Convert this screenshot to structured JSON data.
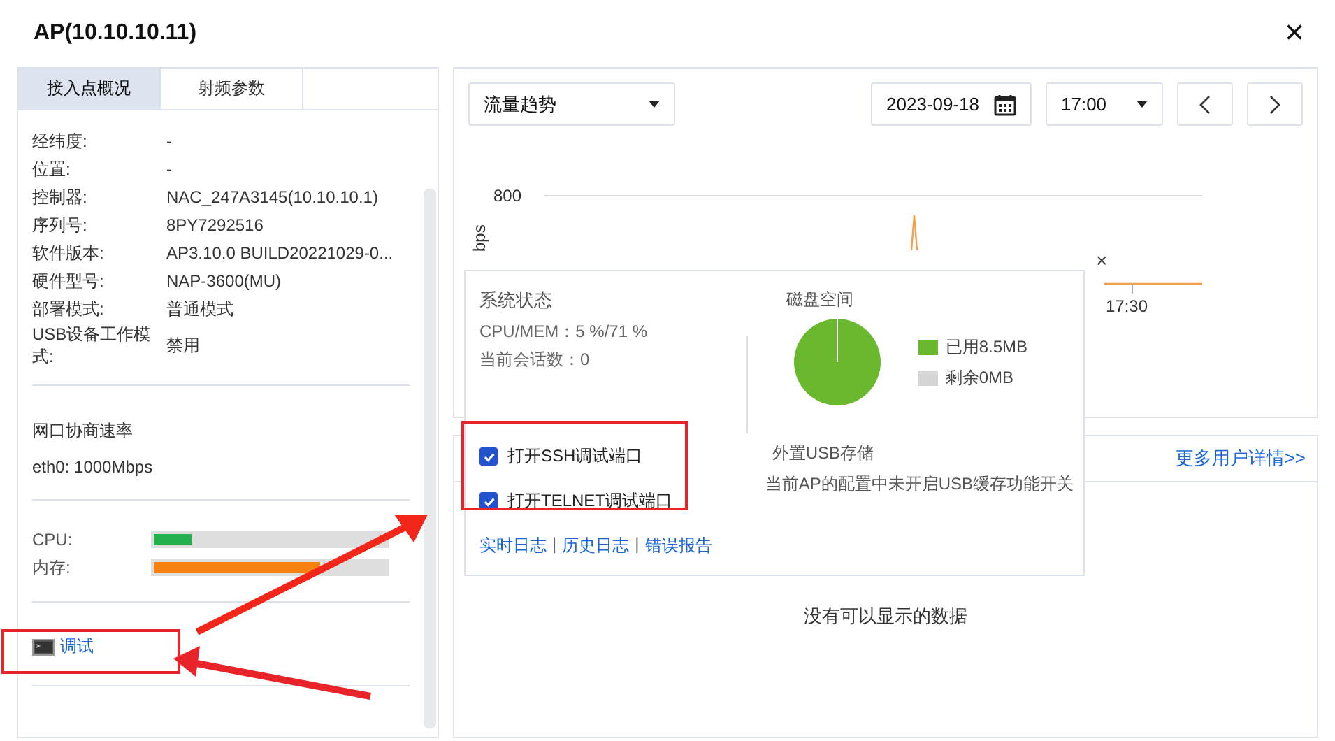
{
  "window": {
    "title": "AP(10.10.10.11)",
    "close": "×"
  },
  "tabs": [
    {
      "label": "接入点概况",
      "selected": true
    },
    {
      "label": "射频参数",
      "selected": false
    }
  ],
  "info_rows": [
    {
      "label": "经纬度:",
      "value": "-"
    },
    {
      "label": "位置:",
      "value": "-"
    },
    {
      "label": "控制器:",
      "value": "NAC_247A3145(10.10.10.1)"
    },
    {
      "label": "序列号:",
      "value": "8PY7292516"
    },
    {
      "label": "软件版本:",
      "value": "AP3.10.0 BUILD20221029-0..."
    },
    {
      "label": "硬件型号:",
      "value": "NAP-3600(MU)"
    },
    {
      "label": "部署模式:",
      "value": "普通模式"
    },
    {
      "label": "USB设备工作模式:",
      "value": "禁用"
    }
  ],
  "port_rate": {
    "title": "网口协商速率",
    "value": "eth0: 1000Mbps"
  },
  "meters": [
    {
      "label": "CPU:",
      "level": 0.16,
      "color": "#22b14c"
    },
    {
      "label": "内存:",
      "level": 0.7,
      "color": "#f78212"
    }
  ],
  "debug_link": "调试",
  "toolbar": {
    "view": "流量趋势",
    "date": "2023-09-18",
    "time": "17:00"
  },
  "chart": {
    "y_tick": "800",
    "y_label": "bps",
    "x_tick": "17:30"
  },
  "popup": {
    "close": "×",
    "status_title": "系统状态",
    "cpu_mem": "CPU/MEM：5 %/71 %",
    "sessions": "当前会话数：0",
    "disk_title": "磁盘空间",
    "legend": [
      {
        "label": "已用8.5MB",
        "color": "#6ab82e"
      },
      {
        "label": "剩余0MB",
        "color": "#d6d6d6"
      }
    ],
    "usb_title": "外置USB存储",
    "usb_note": "当前AP的配置中未开启USB缓存功能开关",
    "checkboxes": [
      {
        "label": "打开SSH调试端口",
        "checked": true
      },
      {
        "label": "打开TELNET调试端口",
        "checked": true
      }
    ],
    "links": [
      "实时日志",
      "历史日志",
      "错误报告"
    ],
    "separator": "|"
  },
  "users_card": {
    "more_link": "更多用户详情>>",
    "empty": "没有可以显示的数据"
  }
}
